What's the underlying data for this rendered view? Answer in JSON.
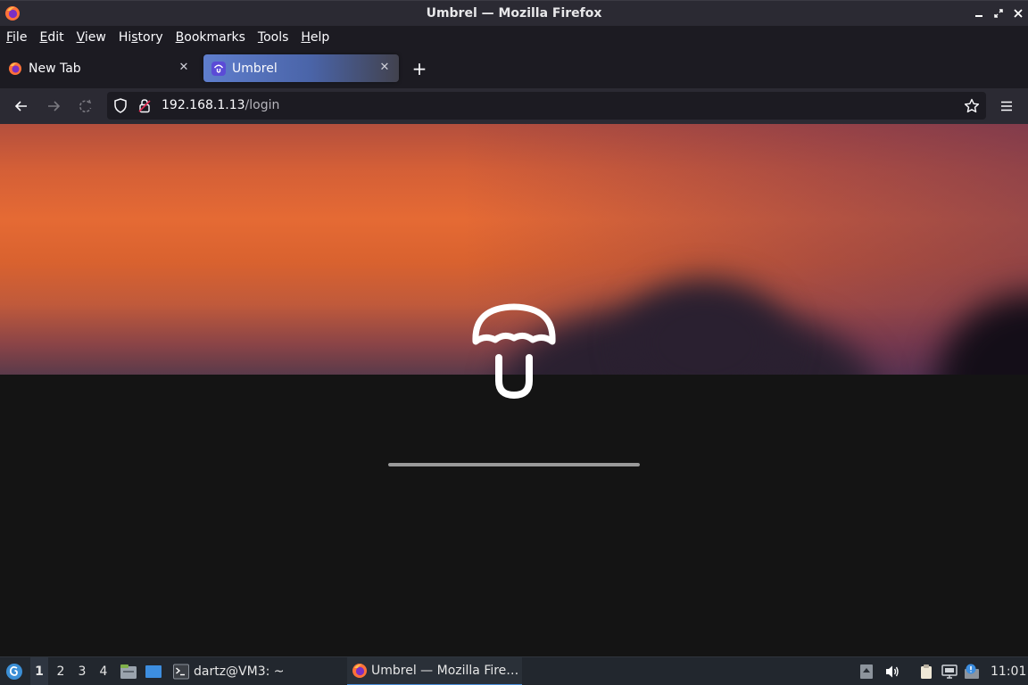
{
  "window": {
    "title": "Umbrel — Mozilla Firefox"
  },
  "menubar": {
    "items": [
      {
        "pre": "",
        "u": "F",
        "post": "ile"
      },
      {
        "pre": "",
        "u": "E",
        "post": "dit"
      },
      {
        "pre": "",
        "u": "V",
        "post": "iew"
      },
      {
        "pre": "Hi",
        "u": "s",
        "post": "tory"
      },
      {
        "pre": "",
        "u": "B",
        "post": "ookmarks"
      },
      {
        "pre": "",
        "u": "T",
        "post": "ools"
      },
      {
        "pre": "",
        "u": "H",
        "post": "elp"
      }
    ]
  },
  "tabs": [
    {
      "label": "New Tab",
      "active": false
    },
    {
      "label": "Umbrel",
      "active": true
    }
  ],
  "navbar": {
    "url_host": "192.168.1.13",
    "url_path": "/login"
  },
  "page": {
    "loading_progress": 1.0
  },
  "taskbar": {
    "workspaces": [
      "1",
      "2",
      "3",
      "4"
    ],
    "active_workspace": "1",
    "terminal_label": "dartz@VM3: ~",
    "firefox_label": "Umbrel — Mozilla Fire…",
    "clock": "11:01"
  },
  "colors": {
    "accent": "#5f7ecd",
    "firefox_orange": "#ff7139",
    "umbrel_purple": "#5b4bd6"
  }
}
